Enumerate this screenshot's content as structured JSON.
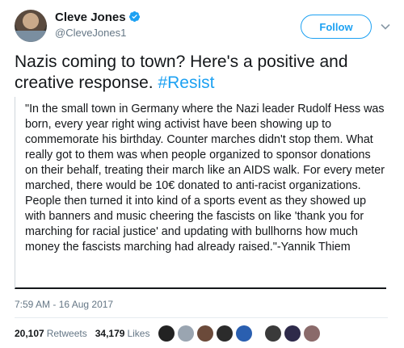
{
  "author": {
    "display_name": "Cleve Jones",
    "handle": "@CleveJones1",
    "verified": true
  },
  "follow_button": {
    "label": "Follow"
  },
  "tweet": {
    "text": "Nazis coming to town? Here's a positive and creative response.",
    "hashtag": "#Resist",
    "quote": "\"In the small town in Germany where the Nazi leader Rudolf Hess was born, every year right wing activist have been showing up to commemorate his birthday. Counter marches didn't stop them. What really got to them was when people organized to sponsor donations on their behalf, treating their march like an AIDS walk. For every meter marched, there would be 10€ donated to anti-racist organizations. People then turned it into kind of a sports event as they showed up with banners and music cheering the fascists on like 'thank you for marching for racial justice' and updating with bullhorns how much money the fascists marching had already raised.\"-Yannik Thiem"
  },
  "timestamp": "7:59 AM - 16 Aug 2017",
  "stats": {
    "retweets_count": "20,107",
    "retweets_label": "Retweets",
    "likes_count": "34,179",
    "likes_label": "Likes"
  },
  "colors": {
    "accent": "#1da1f2",
    "secondary_text": "#657786"
  },
  "likers": [
    {
      "name": "liker-1",
      "color": "#222222"
    },
    {
      "name": "liker-2",
      "color": "#9aa5b1"
    },
    {
      "name": "liker-3",
      "color": "#6b4a3a"
    },
    {
      "name": "liker-4",
      "color": "#2b2b2b"
    },
    {
      "name": "liker-5",
      "color": "#2a5fb0"
    },
    {
      "name": "liker-6",
      "color": "#3a3a3a"
    },
    {
      "name": "liker-7",
      "color": "#2e2a4a"
    },
    {
      "name": "liker-8",
      "color": "#8a6a6a"
    }
  ]
}
